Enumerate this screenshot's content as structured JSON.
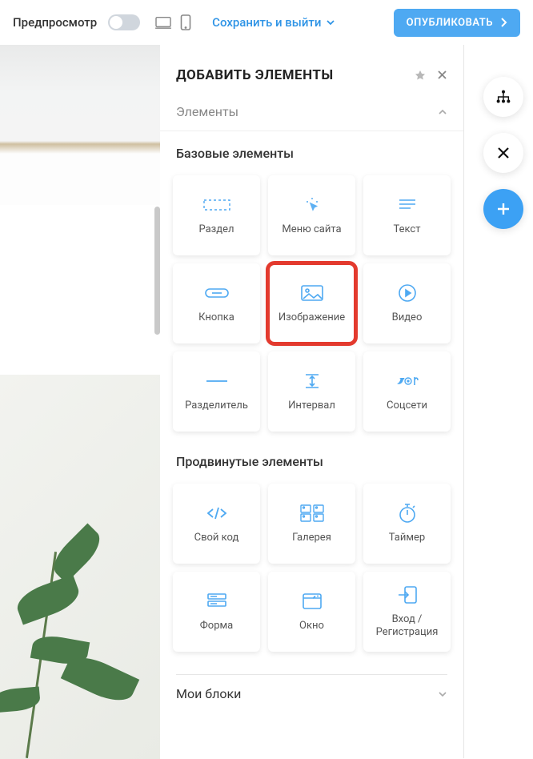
{
  "toolbar": {
    "preview_label": "Предпросмотр",
    "save_exit_label": "Сохранить и выйти",
    "publish_label": "ОПУБЛИКОВАТЬ"
  },
  "panel": {
    "title": "ДОБАВИТЬ ЭЛЕМЕНТЫ",
    "section_elements": "Элементы",
    "basic_title": "Базовые элементы",
    "advanced_title": "Продвинутые элементы",
    "my_blocks": "Мои блоки",
    "tiles": {
      "section": "Раздел",
      "menu": "Меню сайта",
      "text": "Текст",
      "button": "Кнопка",
      "image": "Изображение",
      "video": "Видео",
      "divider": "Разделитель",
      "spacer": "Интервал",
      "social": "Соцсети",
      "code": "Свой код",
      "gallery": "Галерея",
      "timer": "Таймер",
      "form": "Форма",
      "window": "Окно",
      "login": "Вход / Регистрация"
    }
  }
}
